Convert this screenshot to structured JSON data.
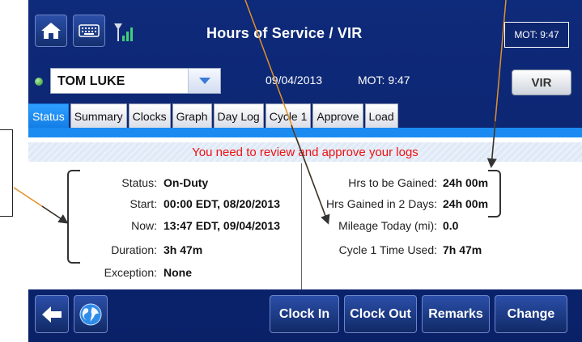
{
  "header": {
    "title": "Hours of Service / VIR",
    "mot_time": "MOT: 9:47"
  },
  "driver": {
    "name": "TOM LUKE",
    "date": "09/04/2013",
    "mot": "MOT: 9:47",
    "vir_label": "VIR",
    "status_color": "#3cb043"
  },
  "tabs": [
    {
      "label": "Status",
      "active": true
    },
    {
      "label": "Summary"
    },
    {
      "label": "Clocks"
    },
    {
      "label": "Graph"
    },
    {
      "label": "Day Log"
    },
    {
      "label": "Cycle 1"
    },
    {
      "label": "Approve"
    },
    {
      "label": "Load"
    }
  ],
  "alert": "You need to review and approve your logs",
  "left_fields": [
    {
      "label": "Status:",
      "value": "On-Duty"
    },
    {
      "label": "Start:",
      "value": "00:00 EDT, 08/20/2013"
    },
    {
      "label": "Now:",
      "value": "13:47 EDT, 09/04/2013"
    },
    {
      "label": "Duration:",
      "value": "3h 47m"
    },
    {
      "label": "Exception:",
      "value": "None"
    }
  ],
  "right_fields": [
    {
      "label": "Hrs to be Gained:",
      "value": "24h 00m"
    },
    {
      "label": "Hrs Gained in 2 Days:",
      "value": "24h 00m"
    },
    {
      "label": "Mileage Today (mi):",
      "value": "0.0"
    },
    {
      "label": "Cycle 1 Time Used:",
      "value": "7h 47m"
    }
  ],
  "buttons": {
    "clock_in": "Clock In",
    "clock_out": "Clock Out",
    "remarks": "Remarks",
    "change": "Change"
  },
  "colors": {
    "background": "#0e2a7a",
    "accent": "#1b8bf2",
    "alert_text": "#ee1111",
    "annotation": "#e0902a"
  }
}
